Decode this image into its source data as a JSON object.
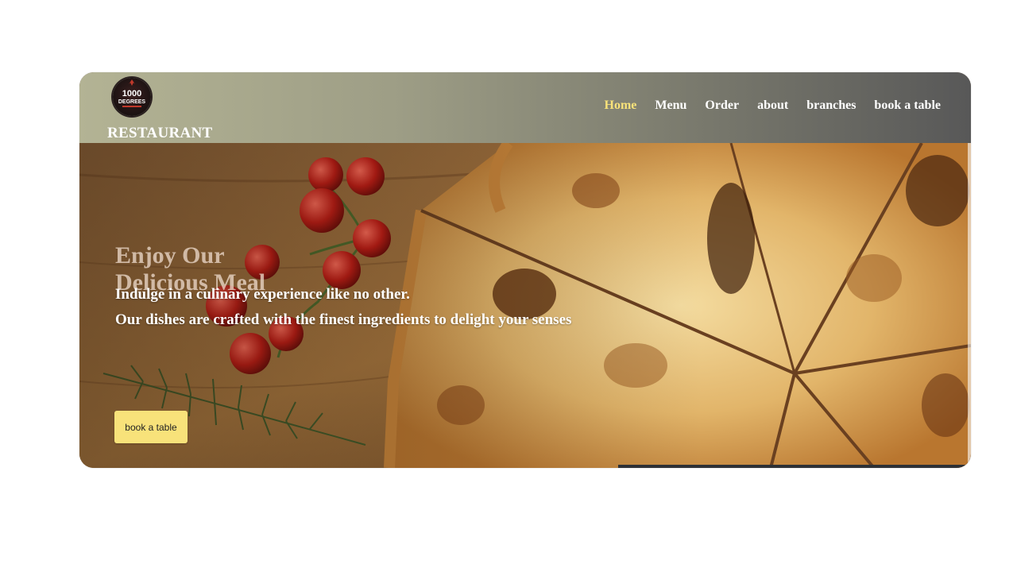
{
  "header": {
    "logo_alt": "1000 DEGREES",
    "logo_text_top": "1000",
    "logo_text_bottom": "DEGREES",
    "brand": "RESTAURANT",
    "nav": [
      {
        "label": "Home",
        "active": true
      },
      {
        "label": "Menu",
        "active": false
      },
      {
        "label": "Order",
        "active": false
      },
      {
        "label": "about",
        "active": false
      },
      {
        "label": "branches",
        "active": false
      },
      {
        "label": "book a table",
        "active": false
      }
    ]
  },
  "hero": {
    "title": "Enjoy Our Delicious Meal",
    "line1": "Indulge in a culinary experience like no other.",
    "line2": "Our dishes are crafted with the finest ingredients to delight your senses",
    "cta_label": "book a table"
  },
  "colors": {
    "accent": "#f8e27a",
    "header_start": "#b3b394",
    "header_end": "#585858"
  }
}
